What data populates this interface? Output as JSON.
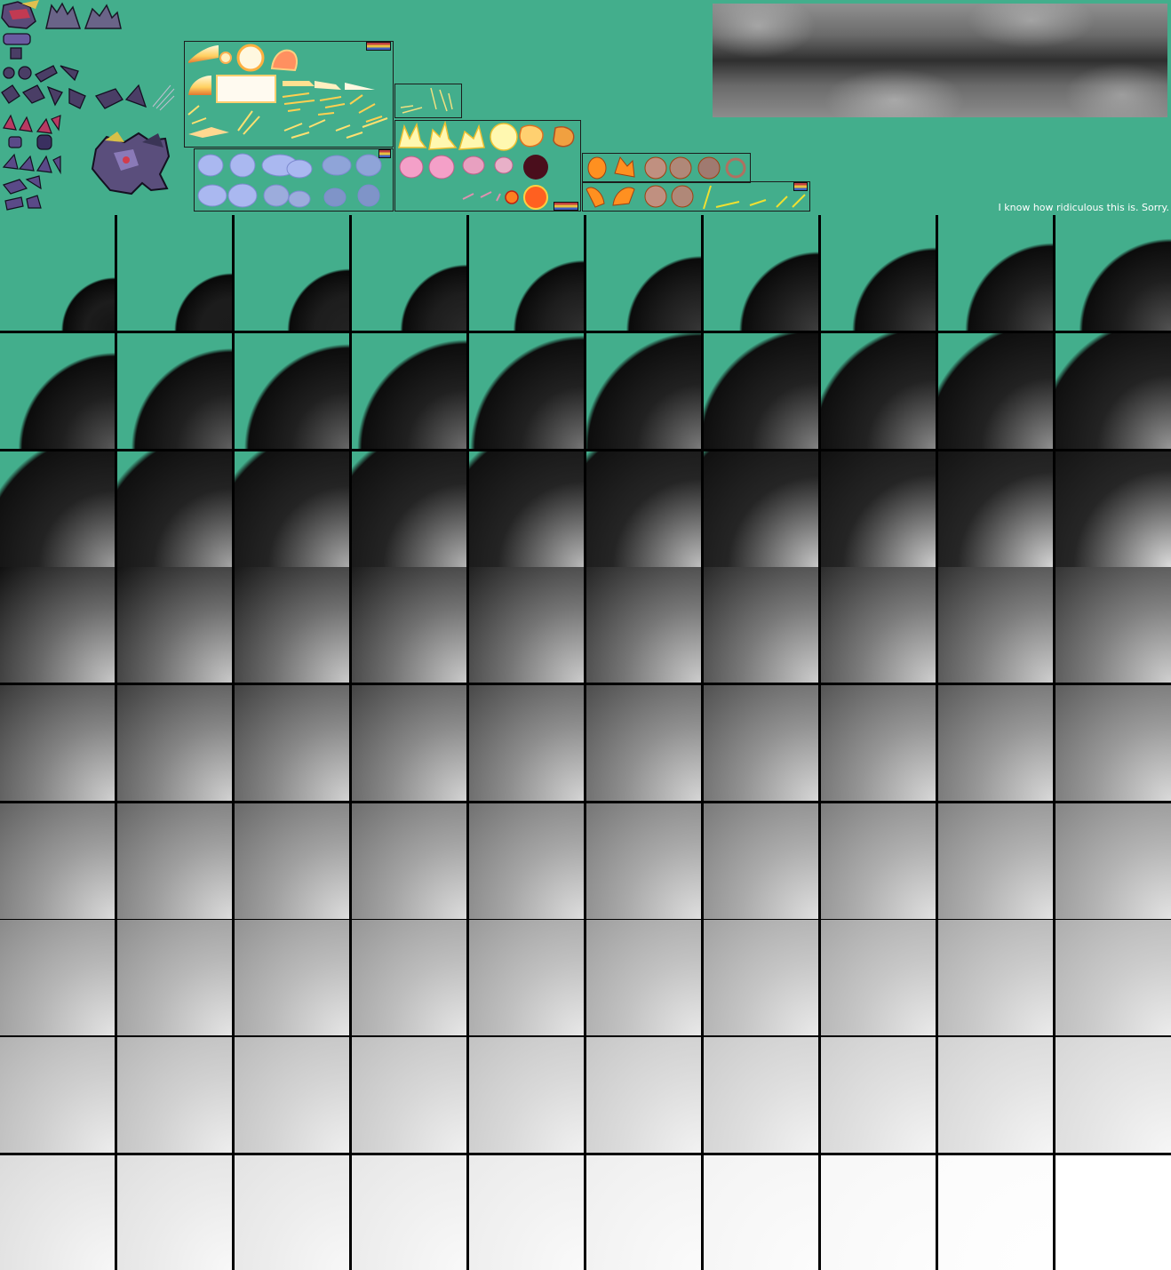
{
  "note": "I know how ridiculous this is. Sorry.",
  "colors": {
    "background": "#43ae8c",
    "divider": "#000000"
  },
  "grid": {
    "rows": 9,
    "cols": 10,
    "frame_count": 90
  }
}
